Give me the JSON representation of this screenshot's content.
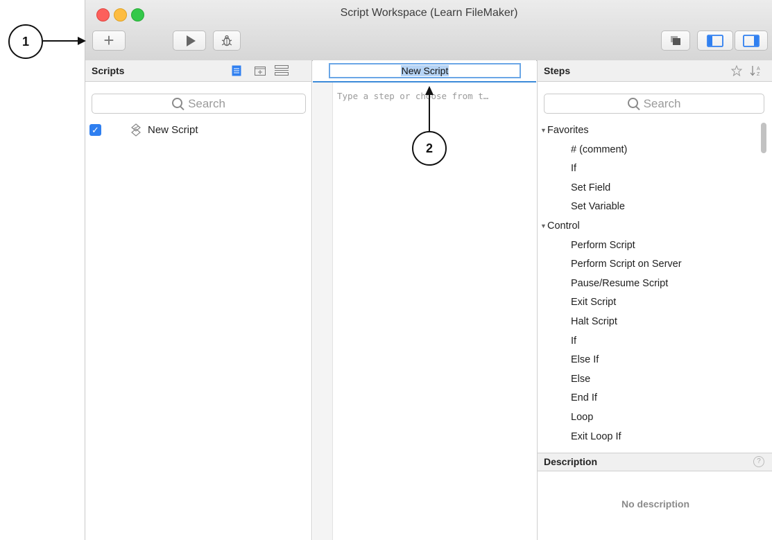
{
  "window": {
    "title": "Script Workspace (Learn FileMaker)"
  },
  "toolbar": {
    "add_icon": "+",
    "debug_icon": "bug-icon"
  },
  "scripts_panel": {
    "title": "Scripts",
    "search_placeholder": "Search",
    "items": [
      {
        "name": "New Script",
        "checked": true
      }
    ]
  },
  "editor": {
    "script_name": "New Script",
    "placeholder": "Type a step or choose from t…"
  },
  "steps_panel": {
    "title": "Steps",
    "search_placeholder": "Search",
    "groups": [
      {
        "label": "Favorites",
        "items": [
          "# (comment)",
          "If",
          "Set Field",
          "Set Variable"
        ]
      },
      {
        "label": "Control",
        "items": [
          "Perform Script",
          "Perform Script on Server",
          "Pause/Resume Script",
          "Exit Script",
          "Halt Script",
          "If",
          "Else If",
          "Else",
          "End If",
          "Loop",
          "Exit Loop If"
        ]
      }
    ]
  },
  "description": {
    "title": "Description",
    "text": "No description"
  },
  "annotations": {
    "callout_1": "1",
    "callout_2": "2"
  },
  "colors": {
    "accent": "#2f7ff0",
    "selection": "#b6d4f5"
  }
}
